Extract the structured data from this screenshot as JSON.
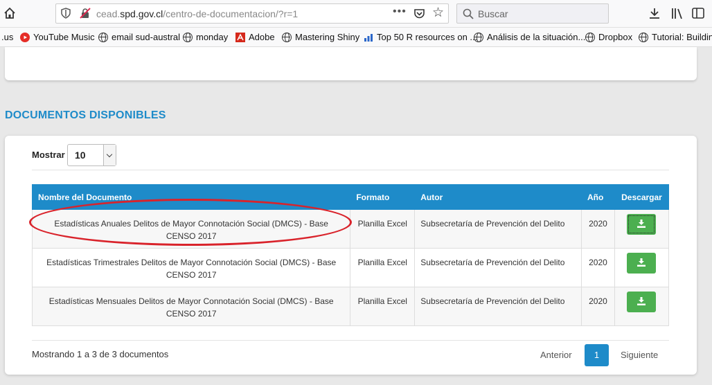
{
  "browser": {
    "url_prefix": "cead.",
    "url_domain": "spd.gov.cl",
    "url_path": "/centro-de-documentacion/?r=1",
    "url_more": "•••",
    "search_placeholder": "Buscar"
  },
  "bookmarks": [
    {
      "label": ".us",
      "icon": "none"
    },
    {
      "label": "YouTube Music",
      "icon": "youtube-music-icon"
    },
    {
      "label": "email sud-austral",
      "icon": "globe-icon"
    },
    {
      "label": "monday",
      "icon": "globe-icon"
    },
    {
      "label": "Adobe",
      "icon": "adobe-icon"
    },
    {
      "label": "Mastering Shiny",
      "icon": "globe-icon"
    },
    {
      "label": "Top 50 R resources on ...",
      "icon": "chart-icon"
    },
    {
      "label": "Análisis de la situación...",
      "icon": "globe-icon"
    },
    {
      "label": "Dropbox",
      "icon": "globe-icon"
    },
    {
      "label": "Tutorial: Building",
      "icon": "globe-icon"
    }
  ],
  "section": {
    "title": "DOCUMENTOS DISPONIBLES"
  },
  "controls": {
    "show_label": "Mostrar",
    "show_value": "10"
  },
  "table": {
    "headers": {
      "name": "Nombre del Documento",
      "format": "Formato",
      "author": "Autor",
      "year": "Año",
      "download": "Descargar"
    },
    "rows": [
      {
        "name": "Estadísticas Anuales Delitos de Mayor Connotación Social (DMCS) - Base CENSO 2017",
        "format": "Planilla Excel",
        "author": "Subsecretaría de Prevención del Delito",
        "year": "2020"
      },
      {
        "name": "Estadísticas Trimestrales Delitos de Mayor Connotación Social (DMCS) - Base CENSO 2017",
        "format": "Planilla Excel",
        "author": "Subsecretaría de Prevención del Delito",
        "year": "2020"
      },
      {
        "name": "Estadísticas Mensuales Delitos de Mayor Connotación Social (DMCS) - Base CENSO 2017",
        "format": "Planilla Excel",
        "author": "Subsecretaría de Prevención del Delito",
        "year": "2020"
      }
    ]
  },
  "footer": {
    "info": "Mostrando 1 a 3 de 3 documentos",
    "prev": "Anterior",
    "current_page": "1",
    "next": "Siguiente"
  },
  "colors": {
    "accent": "#1e8bc9",
    "download": "#4caf50",
    "annotation": "#d9232b"
  }
}
